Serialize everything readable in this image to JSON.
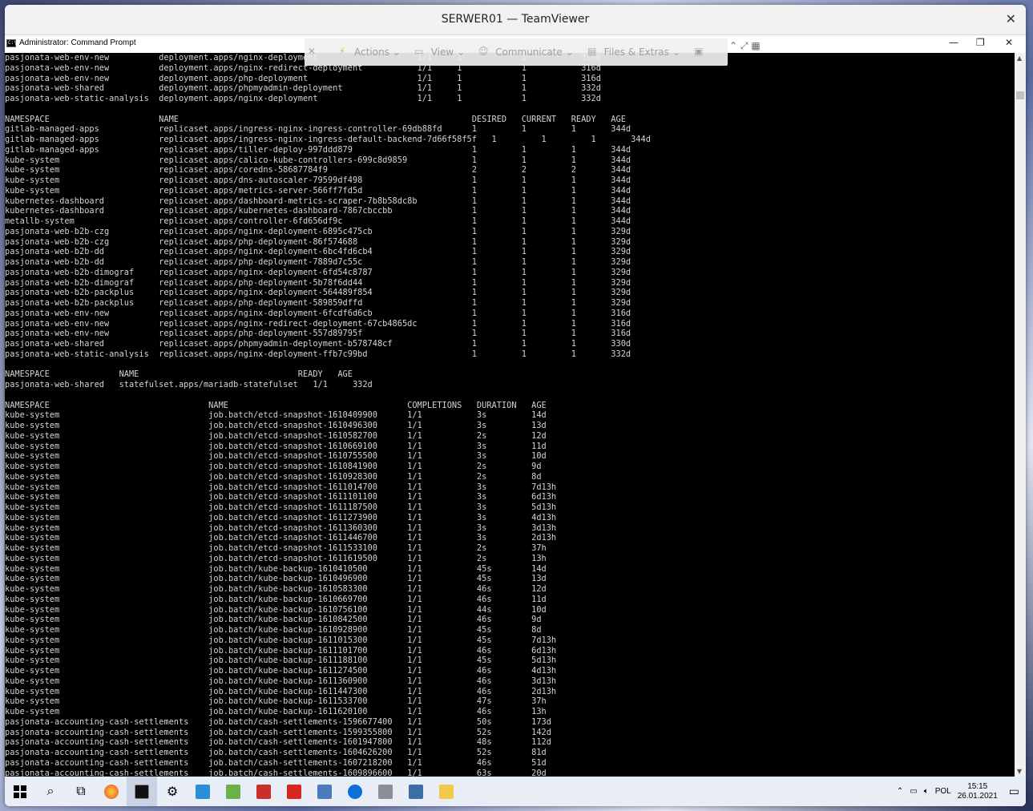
{
  "teamviewer": {
    "title": "SERWER01 — TeamViewer",
    "close": "✕"
  },
  "cmd": {
    "title": "Administrator: Command Prompt",
    "minimize": "—",
    "maximize": "❐",
    "close": "✕"
  },
  "toolbar": {
    "actions": "Actions",
    "view": "View",
    "communicate": "Communicate",
    "files": "Files & Extras"
  },
  "console_lines": [
    "pasjonata-web-env-new          deployment.apps/nginx-deployment                    1/1     1            1           316d",
    "pasjonata-web-env-new          deployment.apps/nginx-redirect-deployment           1/1     1            1           316d",
    "pasjonata-web-env-new          deployment.apps/php-deployment                      1/1     1            1           316d",
    "pasjonata-web-shared           deployment.apps/phpmyadmin-deployment               1/1     1            1           332d",
    "pasjonata-web-static-analysis  deployment.apps/nginx-deployment                    1/1     1            1           332d",
    "",
    "NAMESPACE                      NAME                                                           DESIRED   CURRENT   READY   AGE",
    "gitlab-managed-apps            replicaset.apps/ingress-nginx-ingress-controller-69db88fd      1         1         1       344d",
    "gitlab-managed-apps            replicaset.apps/ingress-nginx-ingress-default-backend-7d66f58f5f   1         1         1       344d",
    "gitlab-managed-apps            replicaset.apps/tiller-deploy-997ddd879                        1         1         1       344d",
    "kube-system                    replicaset.apps/calico-kube-controllers-699c8d9859             1         1         1       344d",
    "kube-system                    replicaset.apps/coredns-58687784f9                             2         2         2       344d",
    "kube-system                    replicaset.apps/dns-autoscaler-79599df498                      1         1         1       344d",
    "kube-system                    replicaset.apps/metrics-server-566ff7fd5d                      1         1         1       344d",
    "kubernetes-dashboard           replicaset.apps/dashboard-metrics-scraper-7b8b58dc8b           1         1         1       344d",
    "kubernetes-dashboard           replicaset.apps/kubernetes-dashboard-7867cbccbb                1         1         1       344d",
    "metallb-system                 replicaset.apps/controller-6fd656df9c                          1         1         1       344d",
    "pasjonata-web-b2b-czg          replicaset.apps/nginx-deployment-6895c475cb                    1         1         1       329d",
    "pasjonata-web-b2b-czg          replicaset.apps/php-deployment-86f574688                       1         1         1       329d",
    "pasjonata-web-b2b-dd           replicaset.apps/nginx-deployment-6bc4fd6cb4                    1         1         1       329d",
    "pasjonata-web-b2b-dd           replicaset.apps/php-deployment-7889d7c55c                      1         1         1       329d",
    "pasjonata-web-b2b-dimograf     replicaset.apps/nginx-deployment-6fd54c8787                    1         1         1       329d",
    "pasjonata-web-b2b-dimograf     replicaset.apps/php-deployment-5b78f6dd44                      1         1         1       329d",
    "pasjonata-web-b2b-packplus     replicaset.apps/nginx-deployment-564489f854                    1         1         1       329d",
    "pasjonata-web-b2b-packplus     replicaset.apps/php-deployment-589859dffd                      1         1         1       329d",
    "pasjonata-web-env-new          replicaset.apps/nginx-deployment-6fcdf6d6cb                    1         1         1       316d",
    "pasjonata-web-env-new          replicaset.apps/nginx-redirect-deployment-67cb4865dc           1         1         1       316d",
    "pasjonata-web-env-new          replicaset.apps/php-deployment-557d89795f                      1         1         1       316d",
    "pasjonata-web-shared           replicaset.apps/phpmyadmin-deployment-b578748cf                1         1         1       330d",
    "pasjonata-web-static-analysis  replicaset.apps/nginx-deployment-ffb7c99bd                     1         1         1       332d",
    "",
    "NAMESPACE              NAME                                READY   AGE",
    "pasjonata-web-shared   statefulset.apps/mariadb-statefulset   1/1     332d",
    "",
    "NAMESPACE                                NAME                                    COMPLETIONS   DURATION   AGE",
    "kube-system                              job.batch/etcd-snapshot-1610409900      1/1           3s         14d",
    "kube-system                              job.batch/etcd-snapshot-1610496300      1/1           3s         13d",
    "kube-system                              job.batch/etcd-snapshot-1610582700      1/1           2s         12d",
    "kube-system                              job.batch/etcd-snapshot-1610669100      1/1           3s         11d",
    "kube-system                              job.batch/etcd-snapshot-1610755500      1/1           3s         10d",
    "kube-system                              job.batch/etcd-snapshot-1610841900      1/1           2s         9d",
    "kube-system                              job.batch/etcd-snapshot-1610928300      1/1           2s         8d",
    "kube-system                              job.batch/etcd-snapshot-1611014700      1/1           3s         7d13h",
    "kube-system                              job.batch/etcd-snapshot-1611101100      1/1           3s         6d13h",
    "kube-system                              job.batch/etcd-snapshot-1611187500      1/1           3s         5d13h",
    "kube-system                              job.batch/etcd-snapshot-1611273900      1/1           3s         4d13h",
    "kube-system                              job.batch/etcd-snapshot-1611360300      1/1           3s         3d13h",
    "kube-system                              job.batch/etcd-snapshot-1611446700      1/1           3s         2d13h",
    "kube-system                              job.batch/etcd-snapshot-1611533100      1/1           2s         37h",
    "kube-system                              job.batch/etcd-snapshot-1611619500      1/1           2s         13h",
    "kube-system                              job.batch/kube-backup-1610410500        1/1           45s        14d",
    "kube-system                              job.batch/kube-backup-1610496900        1/1           45s        13d",
    "kube-system                              job.batch/kube-backup-1610583300        1/1           46s        12d",
    "kube-system                              job.batch/kube-backup-1610669700        1/1           46s        11d",
    "kube-system                              job.batch/kube-backup-1610756100        1/1           44s        10d",
    "kube-system                              job.batch/kube-backup-1610842500        1/1           46s        9d",
    "kube-system                              job.batch/kube-backup-1610928900        1/1           45s        8d",
    "kube-system                              job.batch/kube-backup-1611015300        1/1           45s        7d13h",
    "kube-system                              job.batch/kube-backup-1611101700        1/1           46s        6d13h",
    "kube-system                              job.batch/kube-backup-1611188100        1/1           45s        5d13h",
    "kube-system                              job.batch/kube-backup-1611274500        1/1           46s        4d13h",
    "kube-system                              job.batch/kube-backup-1611360900        1/1           46s        3d13h",
    "kube-system                              job.batch/kube-backup-1611447300        1/1           46s        2d13h",
    "kube-system                              job.batch/kube-backup-1611533700        1/1           47s        37h",
    "kube-system                              job.batch/kube-backup-1611620100        1/1           46s        13h",
    "pasjonata-accounting-cash-settlements    job.batch/cash-settlements-1596677400   1/1           50s        173d",
    "pasjonata-accounting-cash-settlements    job.batch/cash-settlements-1599355800   1/1           52s        142d",
    "pasjonata-accounting-cash-settlements    job.batch/cash-settlements-1601947800   1/1           48s        112d",
    "pasjonata-accounting-cash-settlements    job.batch/cash-settlements-1604626200   1/1           52s        81d",
    "pasjonata-accounting-cash-settlements    job.batch/cash-settlements-1607218200   1/1           46s        51d",
    "pasjonata-accounting-cash-settlements    job.batch/cash-settlements-1609896600   1/1           63s        20d"
  ],
  "tray": {
    "lang": "POL",
    "time": "15:15",
    "date": "26.01.2021"
  },
  "taskbar_icons": [
    "windows-start-icon",
    "search-icon",
    "task-view-icon",
    "firefox-icon",
    "cmd-icon",
    "settings-icon",
    "app-icon",
    "app-icon",
    "app-icon",
    "pdf-icon",
    "app-icon",
    "teamviewer-icon",
    "app-icon",
    "app-icon",
    "folder-icon"
  ]
}
